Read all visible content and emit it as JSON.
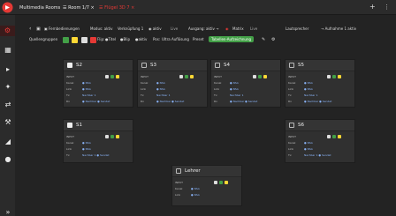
{
  "colors": {
    "accent": "#e53935",
    "green": "#43a047",
    "yellow": "#fdd835",
    "blue": "#1e88e5",
    "link": "#8ab4f8"
  },
  "topbar": {
    "logo_icon": "app-logo-icon",
    "tabs": [
      {
        "label": "Multimedia Rooms"
      },
      {
        "label": "☰  Room 1/7  ×"
      },
      {
        "label": "☰  Flügel 3D 7 ×"
      }
    ],
    "add_icon": "+",
    "menu_icon": "⋮"
  },
  "sidebar": {
    "items": [
      {
        "icon": "⚙"
      },
      {
        "icon": "▦"
      },
      {
        "icon": "▸"
      },
      {
        "icon": "✦"
      },
      {
        "icon": "⇄"
      },
      {
        "icon": "⚒"
      },
      {
        "icon": "◢"
      },
      {
        "icon": "●"
      },
      {
        "icon": "»"
      }
    ]
  },
  "toolbar": {
    "row1": {
      "back": "‹",
      "edit": "▣",
      "source_label": "▣ Fernbedienungen",
      "mode_label": "Modus: aktiv",
      "group_label": "Verknüpfung 1",
      "filter_label": "◉ aktiv",
      "filter_value": "Live",
      "output_label": "Ausgang: aktiv →",
      "output_value": "◉",
      "matrix_label": "Matrix",
      "matrix_value": "Live",
      "speaker_label": "Lautsprecher",
      "speaker_value": "→ Aufnahme 1 aktiv"
    },
    "row2": {
      "sources_label": "Quellengruppen",
      "buttons": [
        "1",
        "2",
        "3",
        "4"
      ],
      "flip_label": "Flip:",
      "flip_on": "●Titel",
      "flip_off": "●Blip",
      "flip_all": "●aktiv",
      "pos_label": "Pos:",
      "pos_value": "Ultra Auflösung",
      "pos_more": "Preset",
      "record_label": "Tabellen-Aufzeichnung",
      "edit_icon": "✎",
      "settings_icon": "⚙"
    }
  },
  "cards": [
    {
      "name": "S2",
      "checked": true,
      "rows": [
        {
          "l": "INPUT",
          "v": ""
        },
        {
          "l": "Kanal",
          "v": "● NSA"
        },
        {
          "l": "Link",
          "v": "● NSA"
        },
        {
          "l": "Tx",
          "v": "Nachbar 1"
        },
        {
          "l": "Rx",
          "v": "● Nachbar  ● Sendet"
        }
      ]
    },
    {
      "name": "S3",
      "checked": false,
      "rows": [
        {
          "l": "INPUT",
          "v": ""
        },
        {
          "l": "Kanal",
          "v": "● NSA"
        },
        {
          "l": "Link",
          "v": "● NSA"
        },
        {
          "l": "Tx",
          "v": "Nachbar 1"
        },
        {
          "l": "Rx",
          "v": "● Nachbar  ● Sendet"
        }
      ]
    },
    {
      "name": "S4",
      "checked": false,
      "rows": [
        {
          "l": "INPUT",
          "v": ""
        },
        {
          "l": "Kanal",
          "v": "● NSA"
        },
        {
          "l": "Link",
          "v": "● NSA"
        },
        {
          "l": "Tx",
          "v": "Nachbar 1"
        },
        {
          "l": "Rx",
          "v": "● Nachbar  ● Sendet"
        }
      ]
    },
    {
      "name": "S5",
      "checked": false,
      "rows": [
        {
          "l": "INPUT",
          "v": ""
        },
        {
          "l": "Kanal",
          "v": "● NSA"
        },
        {
          "l": "Link",
          "v": "● NSA"
        },
        {
          "l": "Tx",
          "v": "Nachbar 1"
        },
        {
          "l": "Rx",
          "v": "● Nachbar  ● Sendet"
        }
      ]
    },
    {
      "name": "S1",
      "checked": true,
      "rows": [
        {
          "l": "INPUT",
          "v": ""
        },
        {
          "l": "Kanal",
          "v": "● NSA"
        },
        {
          "l": "Link",
          "v": "● NSA"
        },
        {
          "l": "Tx",
          "v": "Nachbar 1 ● Sendet"
        }
      ]
    },
    {
      "name": "S6",
      "checked": false,
      "rows": [
        {
          "l": "INPUT",
          "v": ""
        },
        {
          "l": "Kanal",
          "v": "● NSA"
        },
        {
          "l": "Link",
          "v": "● NSA"
        },
        {
          "l": "Tx",
          "v": "Nachbar 1 ● Sendet"
        }
      ]
    },
    {
      "name": "Lehrer",
      "checked": false,
      "rows": [
        {
          "l": "INPUT",
          "v": ""
        },
        {
          "l": "Kanal",
          "v": "● NSA"
        },
        {
          "l": "Link",
          "v": "● NSA"
        }
      ]
    }
  ]
}
